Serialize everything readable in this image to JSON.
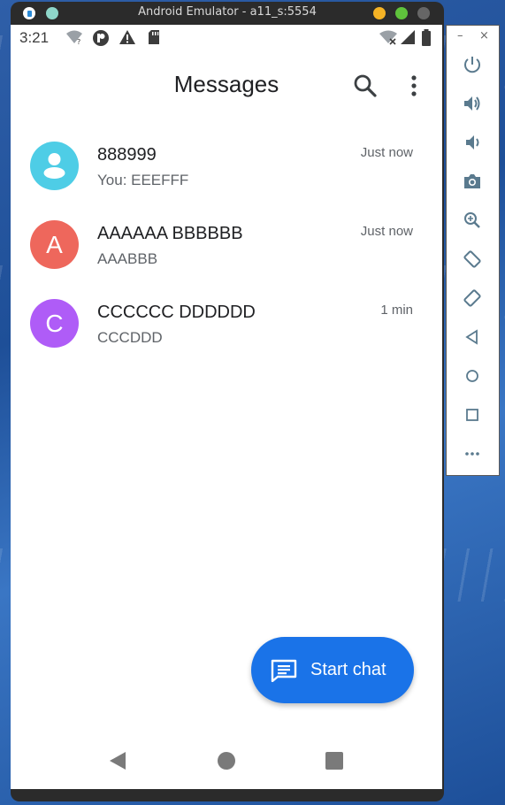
{
  "window": {
    "title": "Android Emulator - a11_s:5554"
  },
  "status_bar": {
    "time": "3:21"
  },
  "app": {
    "title": "Messages"
  },
  "conversations": [
    {
      "name": "888999",
      "snippet": "You: EEEFFF",
      "time": "Just now",
      "avatar_letter": "",
      "avatar_color": "#4ecde6"
    },
    {
      "name": "AAAAAA BBBBBB",
      "snippet": "AAABBB",
      "time": "Just now",
      "avatar_letter": "A",
      "avatar_color": "#ee675c"
    },
    {
      "name": "CCCCCC DDDDDD",
      "snippet": "CCCDDD",
      "time": "1 min",
      "avatar_letter": "C",
      "avatar_color": "#af5cf7"
    }
  ],
  "fab": {
    "label": "Start chat",
    "color": "#1a73e8"
  },
  "side_toolbar": {
    "buttons": [
      "power-icon",
      "volume-up-icon",
      "volume-down-icon",
      "camera-icon",
      "zoom-icon",
      "rotate-left-icon",
      "rotate-right-icon",
      "back-icon",
      "home-icon",
      "overview-icon",
      "more-icon"
    ]
  }
}
